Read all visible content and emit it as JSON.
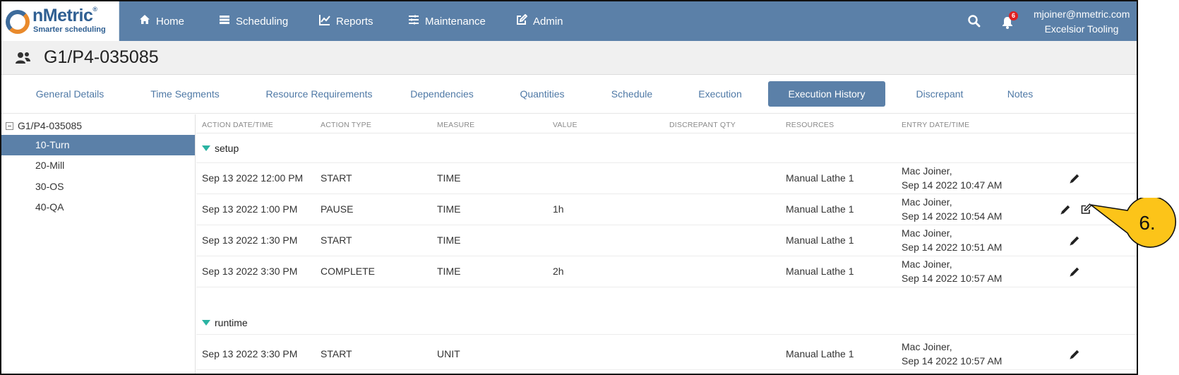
{
  "app": {
    "logo_name": "nMetric",
    "logo_tagline": "Smarter scheduling",
    "nav": [
      "Home",
      "Scheduling",
      "Reports",
      "Maintenance",
      "Admin"
    ],
    "notification_count": "6",
    "user_email": "mjoiner@nmetric.com",
    "company": "Excelsior Tooling"
  },
  "page": {
    "title": "G1/P4-035085"
  },
  "tabs": [
    "General Details",
    "Time Segments",
    "Resource Requirements",
    "Dependencies",
    "Quantities",
    "Schedule",
    "Execution",
    "Execution History",
    "Discrepant",
    "Notes"
  ],
  "active_tab": "Execution History",
  "tree": {
    "root": "G1/P4-035085",
    "items": [
      "10-Turn",
      "20-Mill",
      "30-OS",
      "40-QA"
    ],
    "selected": "10-Turn"
  },
  "table": {
    "headers": [
      "ACTION DATE/TIME",
      "ACTION TYPE",
      "MEASURE",
      "VALUE",
      "DISCREPANT QTY",
      "RESOURCES",
      "ENTRY DATE/TIME"
    ],
    "groups": [
      {
        "name": "setup",
        "rows": [
          {
            "date": "Sep 13 2022 12:00 PM",
            "type": "START",
            "measure": "TIME",
            "value": "",
            "discrepant": "",
            "resource": "Manual Lathe 1",
            "entry_user": "Mac Joiner,",
            "entry_date": "Sep 14 2022 10:47 AM"
          },
          {
            "date": "Sep 13 2022 1:00 PM",
            "type": "PAUSE",
            "measure": "TIME",
            "value": "1h",
            "discrepant": "",
            "resource": "Manual Lathe 1",
            "entry_user": "Mac Joiner,",
            "entry_date": "Sep 14 2022 10:54 AM"
          },
          {
            "date": "Sep 13 2022 1:30 PM",
            "type": "START",
            "measure": "TIME",
            "value": "",
            "discrepant": "",
            "resource": "Manual Lathe 1",
            "entry_user": "Mac Joiner,",
            "entry_date": "Sep 14 2022 10:51 AM"
          },
          {
            "date": "Sep 13 2022 3:30 PM",
            "type": "COMPLETE",
            "measure": "TIME",
            "value": "2h",
            "discrepant": "",
            "resource": "Manual Lathe 1",
            "entry_user": "Mac Joiner,",
            "entry_date": "Sep 14 2022 10:57 AM"
          }
        ]
      },
      {
        "name": "runtime",
        "rows": [
          {
            "date": "Sep 13 2022 3:30 PM",
            "type": "START",
            "measure": "UNIT",
            "value": "",
            "discrepant": "",
            "resource": "Manual Lathe 1",
            "entry_user": "Mac Joiner,",
            "entry_date": "Sep 14 2022 10:57 AM"
          }
        ]
      }
    ]
  },
  "callout": {
    "label": "6."
  },
  "colors": {
    "nav_bg": "#5b80a8",
    "accent_green": "#2ab3a2",
    "callout_fill": "#fcc419"
  }
}
